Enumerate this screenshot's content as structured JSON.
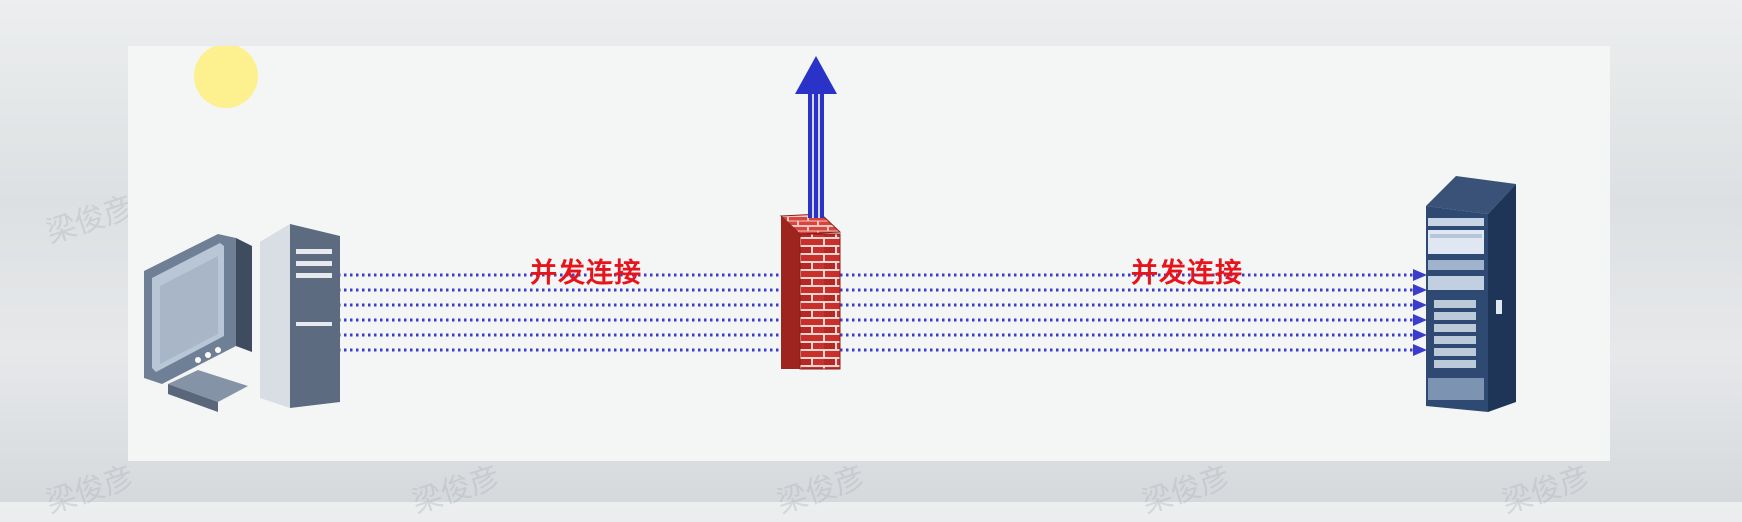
{
  "diagram": {
    "left_label": "并发连接",
    "right_label": "并发连接",
    "connection_count": 6
  },
  "watermark": {
    "text": "梁俊彦"
  },
  "colors": {
    "label": "#e8141c",
    "connection": "#3a3ccc",
    "firewall_brick": "#c9302c",
    "arrow": "#2a32c8",
    "sun": "#fdf08e"
  },
  "icons": [
    "client-computer-icon",
    "server-tower-icon",
    "firewall-icon",
    "upward-arrow-icon",
    "sun-icon"
  ]
}
